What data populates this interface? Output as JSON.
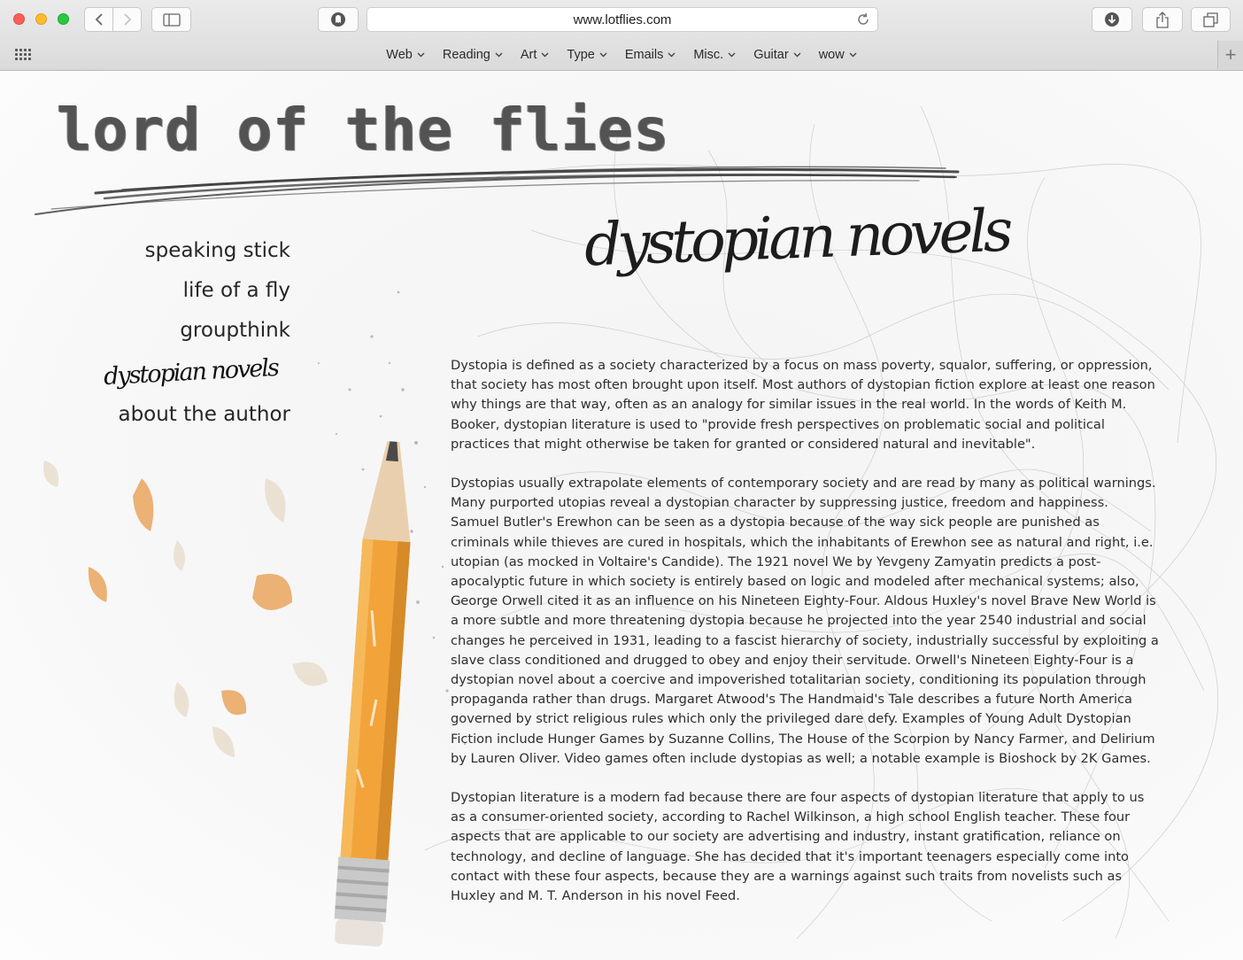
{
  "browser": {
    "url": "www.lotflies.com",
    "favorites": [
      {
        "label": "Web"
      },
      {
        "label": "Reading"
      },
      {
        "label": "Art"
      },
      {
        "label": "Type"
      },
      {
        "label": "Emails"
      },
      {
        "label": "Misc."
      },
      {
        "label": "Guitar"
      },
      {
        "label": "wow"
      }
    ]
  },
  "site": {
    "title": "lord of the flies"
  },
  "nav": {
    "items": [
      {
        "label": "speaking stick"
      },
      {
        "label": "life of a fly"
      },
      {
        "label": "groupthink"
      },
      {
        "label": "dystopian novels",
        "active": true
      },
      {
        "label": "about the author"
      }
    ]
  },
  "main": {
    "heading": "dystopian novels",
    "paragraphs": [
      "Dystopia is defined as a society characterized by a focus on mass poverty, squalor, suffering, or oppression, that society has most often brought upon itself. Most authors of dystopian fiction explore at least one reason why things are that way, often as an analogy for similar issues in the real world. In the words of Keith M. Booker, dystopian literature is used to \"provide fresh perspectives on problematic social and political practices that might otherwise be taken for granted or considered natural and inevitable\".",
      "Dystopias usually extrapolate elements of contemporary society and are read by many as political warnings. Many purported utopias reveal a dystopian character by suppressing justice, freedom and happiness. Samuel Butler's Erewhon can be seen as a dystopia because of the way sick people are punished as criminals while thieves are cured in hospitals, which the inhabitants of Erewhon see as natural and right, i.e. utopian (as mocked in Voltaire's Candide). The 1921 novel We by Yevgeny Zamyatin predicts a post-apocalyptic future in which society is entirely based on logic and modeled after mechanical systems; also, George Orwell cited it as an influence on his Nineteen Eighty-Four. Aldous Huxley's novel Brave New World is a more subtle and more threatening dystopia because he projected into the year 2540 industrial and social changes he perceived in 1931, leading to a fascist hierarchy of society, industrially successful by exploiting a slave class conditioned and drugged to obey and enjoy their servitude. Orwell's Nineteen Eighty-Four is a dystopian novel about a coercive and impoverished totalitarian society, conditioning its population through propaganda rather than drugs. Margaret Atwood's The Handmaid's Tale describes a future North America governed by strict religious rules which only the privileged dare defy. Examples of Young Adult Dystopian Fiction include Hunger Games by Suzanne Collins, The House of the Scorpion by Nancy Farmer, and Delirium by Lauren Oliver. Video games often include dystopias as well; a notable example is Bioshock by 2K Games.",
      "Dystopian literature is a modern fad because there are four aspects of dystopian literature that apply to us as a consumer-oriented society, according to Rachel Wilkinson, a high school English teacher. These four aspects that are applicable to our society are advertising and industry, instant gratification, reliance on technology, and decline of language. She has decided that it's important teenagers especially come into contact with these four aspects, because they are a warnings against such traits from novelists such as Huxley and M. T. Anderson in his novel Feed."
    ]
  },
  "colors": {
    "close": "#fc5f57",
    "minimize": "#fdbb2e",
    "maximize": "#2ac840",
    "pencil": "#f2a43a",
    "graphite": "#3d3d3d"
  }
}
